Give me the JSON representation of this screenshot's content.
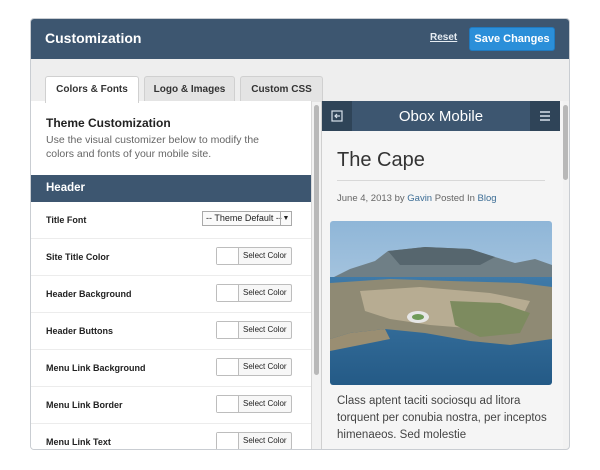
{
  "header": {
    "title": "Customization",
    "reset_label": "Reset",
    "save_label": "Save Changes"
  },
  "tabs": [
    {
      "label": "Colors & Fonts",
      "active": true
    },
    {
      "label": "Logo & Images",
      "active": false
    },
    {
      "label": "Custom CSS",
      "active": false
    }
  ],
  "intro": {
    "heading": "Theme Customization",
    "description": "Use the visual customizer below to modify the colors and fonts of your mobile site."
  },
  "section": {
    "title": "Header"
  },
  "settings": [
    {
      "label": "Title Font",
      "control": "select",
      "value": "-- Theme Default --"
    },
    {
      "label": "Site Title Color",
      "control": "color",
      "button": "Select Color"
    },
    {
      "label": "Header Background",
      "control": "color",
      "button": "Select Color"
    },
    {
      "label": "Header Buttons",
      "control": "color",
      "button": "Select Color"
    },
    {
      "label": "Menu Link Background",
      "control": "color",
      "button": "Select Color"
    },
    {
      "label": "Menu Link Border",
      "control": "color",
      "button": "Select Color"
    },
    {
      "label": "Menu Link Text",
      "control": "color",
      "button": "Select Color"
    }
  ],
  "preview": {
    "site_title": "Obox Mobile",
    "post_title": "The Cape",
    "meta": {
      "date": "June 4, 2013",
      "by": "by",
      "author": "Gavin",
      "posted_in": "Posted In",
      "category": "Blog"
    },
    "body": "Class aptent taciti sociosqu ad litora torquent per conubia nostra, per inceptos himenaeos. Sed molestie"
  },
  "icons": {
    "left_button": "sidebar-toggle-icon",
    "right_button": "hamburger-menu-icon"
  },
  "colors": {
    "header_bar": "#3d5670",
    "save_button": "#2b8fd9",
    "link": "#3d6e96"
  }
}
